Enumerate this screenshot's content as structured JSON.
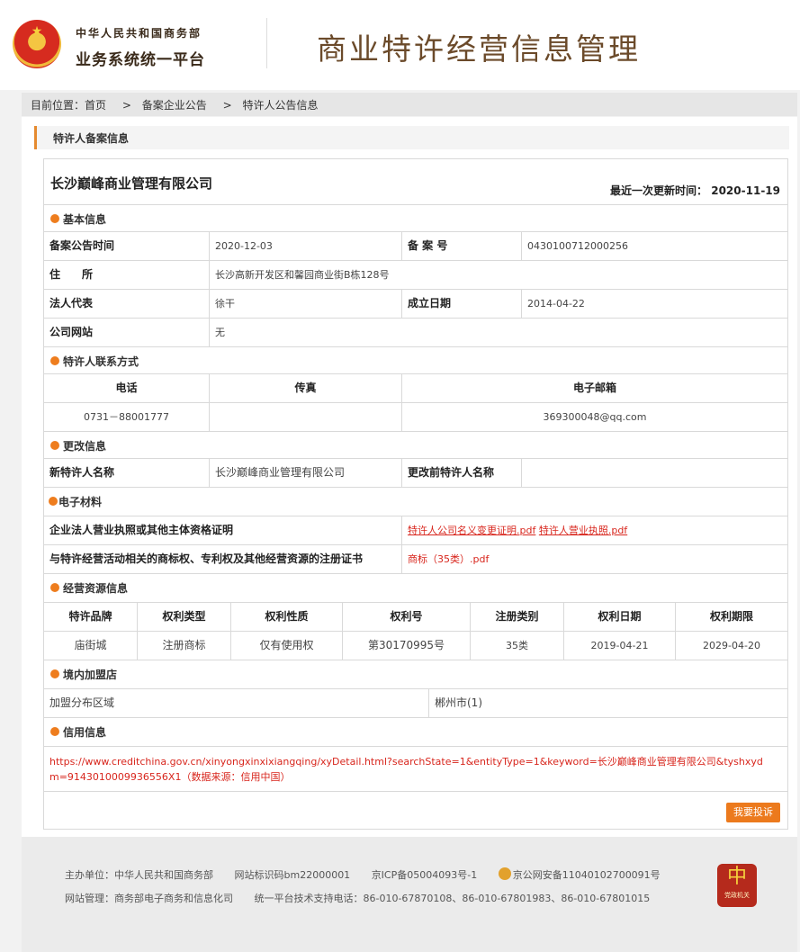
{
  "header": {
    "org_line1": "中华人民共和国商务部",
    "org_line2": "业务系统统一平台",
    "app_title": "商业特许经营信息管理"
  },
  "breadcrumb": {
    "prefix": "目前位置：",
    "items": [
      "首页",
      "备案企业公告",
      "特许人公告信息"
    ],
    "separator": ">"
  },
  "panel": {
    "title": "特许人备案信息"
  },
  "company": {
    "name": "长沙巅峰商业管理有限公司",
    "updated_label": "最近一次更新时间：",
    "updated_value": "2020-11-19"
  },
  "basic": {
    "title": "基本信息",
    "announce_label": "备案公告时间",
    "announce_value": "2020-12-03",
    "record_no_label": "备 案 号",
    "record_no_value": "0430100712000256",
    "address_label": "住　　所",
    "address_value": "长沙高新开发区和馨园商业街B栋128号",
    "legal_label": "法人代表",
    "legal_value": "徐干",
    "founded_label": "成立日期",
    "founded_value": "2014-04-22",
    "website_label": "公司网站",
    "website_value": "无"
  },
  "contact": {
    "title": "特许人联系方式",
    "headers": [
      "电话",
      "传真",
      "电子邮箱"
    ],
    "phone": "0731－88001777",
    "fax": "",
    "email": "369300048@qq.com"
  },
  "change": {
    "title": "更改信息",
    "new_name_label": "新特许人名称",
    "new_name_value": "长沙巅峰商业管理有限公司",
    "old_name_label": "更改前特许人名称",
    "old_name_value": ""
  },
  "materials": {
    "title": "电子材料",
    "row1_label": "企业法人营业执照或其他主体资格证明",
    "row1_files": [
      "特许人公司名义变更证明.pdf",
      "特许人营业执照.pdf"
    ],
    "row2_label": "与特许经营活动相关的商标权、专利权及其他经营资源的注册证书",
    "row2_files": [
      "商标（35类）.pdf"
    ]
  },
  "resources": {
    "title": "经营资源信息",
    "headers": [
      "特许品牌",
      "权利类型",
      "权利性质",
      "权利号",
      "注册类别",
      "权利日期",
      "权利期限"
    ],
    "rows": [
      [
        "庙街城",
        "注册商标",
        "仅有使用权",
        "第30170995号",
        "35类",
        "2019-04-21",
        "2029-04-20"
      ]
    ]
  },
  "franchise": {
    "title": "境内加盟店",
    "region_label": "加盟分布区域",
    "region_value": "郴州市(1)"
  },
  "credit": {
    "title": "信用信息",
    "link_text": "https://www.creditchina.gov.cn/xinyongxinxixiangqing/xyDetail.html?searchState=1&entityType=1&keyword=长沙巅峰商业管理有限公司&tyshxydm=914301000993655​6X1",
    "source": "（数据来源：信用中国）",
    "report_button": "我要投诉"
  },
  "footer": {
    "sponsor": "主办单位：中华人民共和国商务部",
    "site_code": "网站标识码bm22000001",
    "icp": "京ICP备05004093号-1",
    "police": "京公网安备11040102700091号",
    "manager": "网站管理：商务部电子商务和信息化司",
    "support": "统一平台技术支持电话：86-010-67870108、86-010-67801983、86-010-67801015",
    "badge_text": "党政机关"
  },
  "colors": {
    "accent": "#ec7a1d",
    "link_red": "#d8261d",
    "title_brown": "#6b4a2a"
  }
}
